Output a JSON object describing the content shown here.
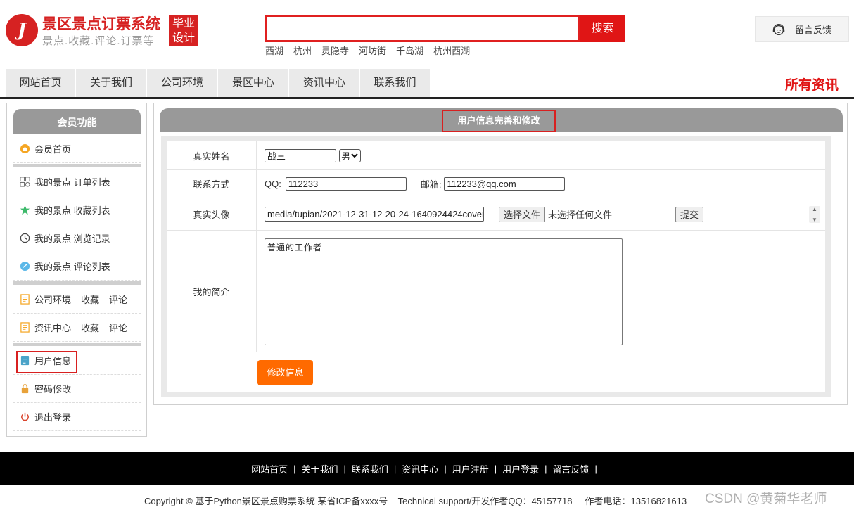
{
  "header": {
    "logo_letter": "J",
    "site_title": "景区景点订票系统",
    "site_subtitle": "景点.收藏.评论.订票等",
    "badge_line1": "毕业",
    "badge_line2": "设计",
    "search_placeholder": "",
    "search_button": "搜索",
    "hot_words": [
      "西湖",
      "杭州",
      "灵隐寺",
      "河坊街",
      "千岛湖",
      "杭州西湖"
    ],
    "feedback_button": "留言反馈"
  },
  "nav": {
    "items": [
      "网站首页",
      "关于我们",
      "公司环境",
      "景区中心",
      "资讯中心",
      "联系我们"
    ],
    "right_label": "所有资讯"
  },
  "sidebar": {
    "title": "会员功能",
    "home": "会员首页",
    "orders": "我的景点 订单列表",
    "favorites": "我的景点 收藏列表",
    "history": "我的景点 浏览记录",
    "comments": "我的景点 评论列表",
    "env": "公司环境",
    "env_fav": "收藏",
    "env_comment": "评论",
    "news": "资讯中心",
    "news_fav": "收藏",
    "news_comment": "评论",
    "user_info": "用户信息",
    "password": "密码修改",
    "logout": "退出登录"
  },
  "main": {
    "title": "用户信息完善和修改",
    "name_label": "真实姓名",
    "name_value": "战三",
    "gender_value": "男",
    "contact_label": "联系方式",
    "qq_label": "QQ:",
    "qq_value": "112233",
    "email_label": "邮箱:",
    "email_value": "112233@qq.com",
    "avatar_label": "真实头像",
    "avatar_path": "media/tupian/2021-12-31-12-20-24-1640924424cover",
    "choose_file": "选择文件",
    "no_file": "未选择任何文件",
    "upload_submit": "提交",
    "bio_label": "我的简介",
    "bio_value": "普通的工作者",
    "submit_button": "修改信息"
  },
  "footer": {
    "links": [
      "网站首页",
      "关于我们",
      "联系我们",
      "资讯中心",
      "用户注册",
      "用户登录",
      "留言反馈"
    ],
    "separator": "|",
    "copyright": "Copyright © 基于Python景区景点购票系统 某省ICP备xxxx号    Technical support/开发作者QQ：45157718     作者电话：13516821613",
    "watermark": "CSDN @黄菊华老师"
  }
}
